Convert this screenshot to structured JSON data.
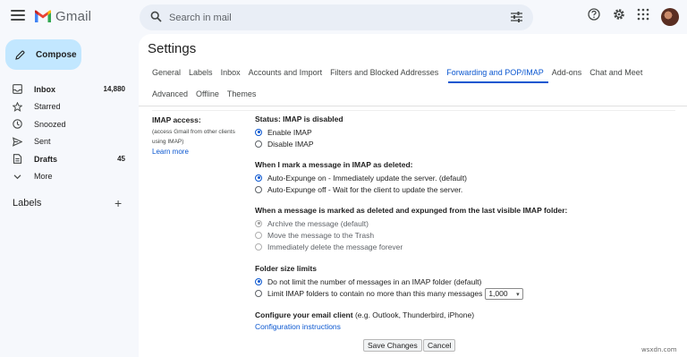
{
  "app": {
    "logo_text": "Gmail"
  },
  "search": {
    "placeholder": "Search in mail"
  },
  "sidebar": {
    "compose_label": "Compose",
    "items": [
      {
        "label": "Inbox",
        "count": "14,880",
        "icon": "inbox-icon",
        "bold": true
      },
      {
        "label": "Starred",
        "count": "",
        "icon": "star-icon",
        "bold": false
      },
      {
        "label": "Snoozed",
        "count": "",
        "icon": "clock-icon",
        "bold": false
      },
      {
        "label": "Sent",
        "count": "",
        "icon": "send-icon",
        "bold": false
      },
      {
        "label": "Drafts",
        "count": "45",
        "icon": "draft-icon",
        "bold": true
      },
      {
        "label": "More",
        "count": "",
        "icon": "chevron-down-icon",
        "bold": false
      }
    ],
    "labels_heading": "Labels",
    "labels_add": "+"
  },
  "main": {
    "title": "Settings",
    "tabs_row1": [
      "General",
      "Labels",
      "Inbox",
      "Accounts and Import",
      "Filters and Blocked Addresses",
      "Forwarding and POP/IMAP",
      "Add-ons",
      "Chat and Meet"
    ],
    "tabs_row2": [
      "Advanced",
      "Offline",
      "Themes"
    ],
    "active_tab": "Forwarding and POP/IMAP"
  },
  "imap": {
    "label": "IMAP access:",
    "description_line1": "(access Gmail from other clients",
    "description_line2": "using IMAP)",
    "learn_more": "Learn more",
    "status": "Status: IMAP is disabled",
    "enable": "Enable IMAP",
    "disable": "Disable IMAP",
    "deleted_title": "When I mark a message in IMAP as deleted:",
    "expunge_on": "Auto-Expunge on - Immediately update the server. (default)",
    "expunge_off": "Auto-Expunge off - Wait for the client to update the server.",
    "expunged_title": "When a message is marked as deleted and expunged from the last visible IMAP folder:",
    "archive": "Archive the message (default)",
    "trash": "Move the message to the Trash",
    "delete_forever": "Immediately delete the message forever",
    "folder_title": "Folder size limits",
    "no_limit": "Do not limit the number of messages in an IMAP folder (default)",
    "limit": "Limit IMAP folders to contain no more than this many messages",
    "limit_value": "1,000",
    "client_title": "Configure your email client",
    "client_hint": " (e.g. Outlook, Thunderbird, iPhone)",
    "config_link": "Configuration instructions"
  },
  "footer": {
    "save": "Save Changes",
    "cancel": "Cancel"
  },
  "watermark": "wsxdn.com",
  "colors": {
    "accent": "#0b57d0",
    "compose_bg": "#c2e7ff",
    "page_bg": "#f6f8fc"
  }
}
